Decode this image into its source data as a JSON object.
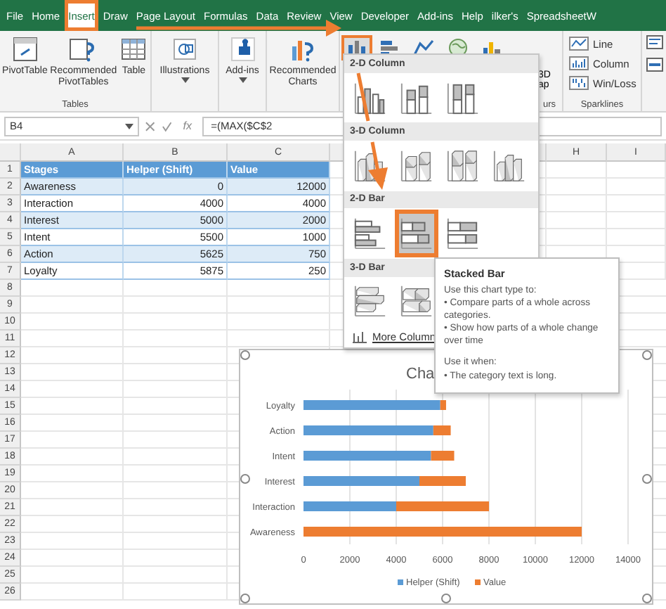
{
  "tabs": [
    {
      "label": "File",
      "selected": false
    },
    {
      "label": "Home",
      "selected": false
    },
    {
      "label": "Insert",
      "selected": true
    },
    {
      "label": "Draw",
      "selected": false
    },
    {
      "label": "Page Layout",
      "selected": false
    },
    {
      "label": "Formulas",
      "selected": false
    },
    {
      "label": "Data",
      "selected": false
    },
    {
      "label": "Review",
      "selected": false
    },
    {
      "label": "View",
      "selected": false
    },
    {
      "label": "Developer",
      "selected": false
    },
    {
      "label": "Add-ins",
      "selected": false
    },
    {
      "label": "Help",
      "selected": false
    },
    {
      "label": "ilker's",
      "selected": false
    },
    {
      "label": "SpreadsheetW",
      "selected": false
    }
  ],
  "ribbon": {
    "groups": [
      {
        "label": "Tables",
        "buttons": [
          {
            "label": "PivotTable",
            "kind": "pivot",
            "menu": false
          },
          {
            "label": "Recommended PivotTables",
            "kind": "rec-pivot",
            "menu": false
          },
          {
            "label": "Table",
            "kind": "table",
            "menu": false
          }
        ]
      },
      {
        "buttons": [
          {
            "label": "Illustrations",
            "kind": "shapes",
            "menu": true
          }
        ]
      },
      {
        "buttons": [
          {
            "label": "Add-ins",
            "kind": "addin",
            "menu": true
          }
        ]
      },
      {
        "buttons": [
          {
            "label": "Recommended Charts",
            "kind": "rec-chart",
            "menu": false
          }
        ]
      }
    ],
    "chart_buttons": [
      {
        "kind": "column",
        "selected": true
      },
      {
        "kind": "bar",
        "selected": false
      },
      {
        "kind": "line",
        "selected": false
      },
      {
        "kind": "map",
        "selected": false
      },
      {
        "kind": "pivot-chart",
        "selected": false
      }
    ],
    "map_group": {
      "line_1": "3D",
      "line_2": "ap",
      "label": "urs"
    },
    "sparklines": {
      "label": "Sparklines",
      "items": [
        {
          "label": "Line",
          "kind": "line"
        },
        {
          "label": "Column",
          "kind": "column"
        },
        {
          "label": "Win/Loss",
          "kind": "winloss"
        }
      ]
    }
  },
  "formula_bar": {
    "name_box": "B4",
    "fx": "fx",
    "formula": "=(MAX($C$2"
  },
  "columns": [
    {
      "label": "A"
    },
    {
      "label": "B"
    },
    {
      "label": "C"
    }
  ],
  "far_columns": [
    {
      "label": "H"
    },
    {
      "label": "I"
    }
  ],
  "row_numbers": [
    "1",
    "2",
    "3",
    "4",
    "5",
    "6",
    "7",
    "8",
    "9",
    "10",
    "11",
    "12",
    "13",
    "14",
    "15",
    "16",
    "17",
    "18",
    "19",
    "20",
    "21",
    "22",
    "23",
    "24",
    "25",
    "26"
  ],
  "data_rows": [
    {
      "kind": "header",
      "cells": [
        "Stages",
        "Helper (Shift)",
        "Value"
      ]
    },
    {
      "kind": "banded",
      "cells": [
        "Awareness",
        "0",
        "12000"
      ]
    },
    {
      "kind": "plain",
      "cells": [
        "Interaction",
        "4000",
        "4000"
      ]
    },
    {
      "kind": "banded",
      "cells": [
        "Interest",
        "5000",
        "2000"
      ]
    },
    {
      "kind": "plain",
      "cells": [
        "Intent",
        "5500",
        "1000"
      ]
    },
    {
      "kind": "banded",
      "cells": [
        "Action",
        "5625",
        "750"
      ]
    },
    {
      "kind": "plain",
      "cells": [
        "Loyalty",
        "5875",
        "250"
      ]
    }
  ],
  "chart_menu": {
    "sections": [
      {
        "title": "2-D Column",
        "items": [
          {
            "kind": "clustered-column",
            "selected": false
          },
          {
            "kind": "stacked-column",
            "selected": false
          },
          {
            "kind": "full-column",
            "selected": false
          }
        ]
      },
      {
        "title": "3-D Column",
        "items": [
          {
            "kind": "deep-clustered-column",
            "selected": false
          },
          {
            "kind": "deep-stacked-column",
            "selected": false
          },
          {
            "kind": "deep-full-column",
            "selected": false
          },
          {
            "kind": "deep-column",
            "selected": false
          }
        ]
      },
      {
        "title": "2-D Bar",
        "items": [
          {
            "kind": "clustered-bar",
            "selected": false
          },
          {
            "kind": "stacked-bar",
            "selected": true
          },
          {
            "kind": "full-bar",
            "selected": false
          }
        ]
      },
      {
        "title": "3-D Bar",
        "items": [
          {
            "kind": "deep-clustered-bar",
            "selected": false
          },
          {
            "kind": "deep-stacked-bar",
            "selected": false
          }
        ]
      }
    ],
    "more": "More Column"
  },
  "tooltip": {
    "title": "Stacked Bar",
    "intro": "Use this chart type to:",
    "bullets": [
      "• Compare parts of a whole across categories.",
      "• Show how parts of a whole change over time"
    ],
    "when_title": "Use it when:",
    "when_bullets": [
      "• The category text is long."
    ]
  },
  "chart": {
    "chart_data": {
      "type": "bar",
      "orientation": "horizontal",
      "stacked": true,
      "title": "Cha",
      "categories": [
        "Loyalty",
        "Action",
        "Intent",
        "Interest",
        "Interaction",
        "Awareness"
      ],
      "series": [
        {
          "name": "Helper (Shift)",
          "color": "#5b9bd5",
          "values": [
            5900,
            5600,
            5500,
            5000,
            4000,
            0
          ]
        },
        {
          "name": "Value",
          "color": "#ed7d31",
          "values": [
            250,
            750,
            1000,
            2000,
            4000,
            12000
          ]
        }
      ],
      "grid": true,
      "legend": true,
      "xlim": [
        0,
        14000
      ],
      "xticks": [
        0,
        2000,
        4000,
        6000,
        8000,
        10000,
        12000,
        14000
      ]
    }
  }
}
